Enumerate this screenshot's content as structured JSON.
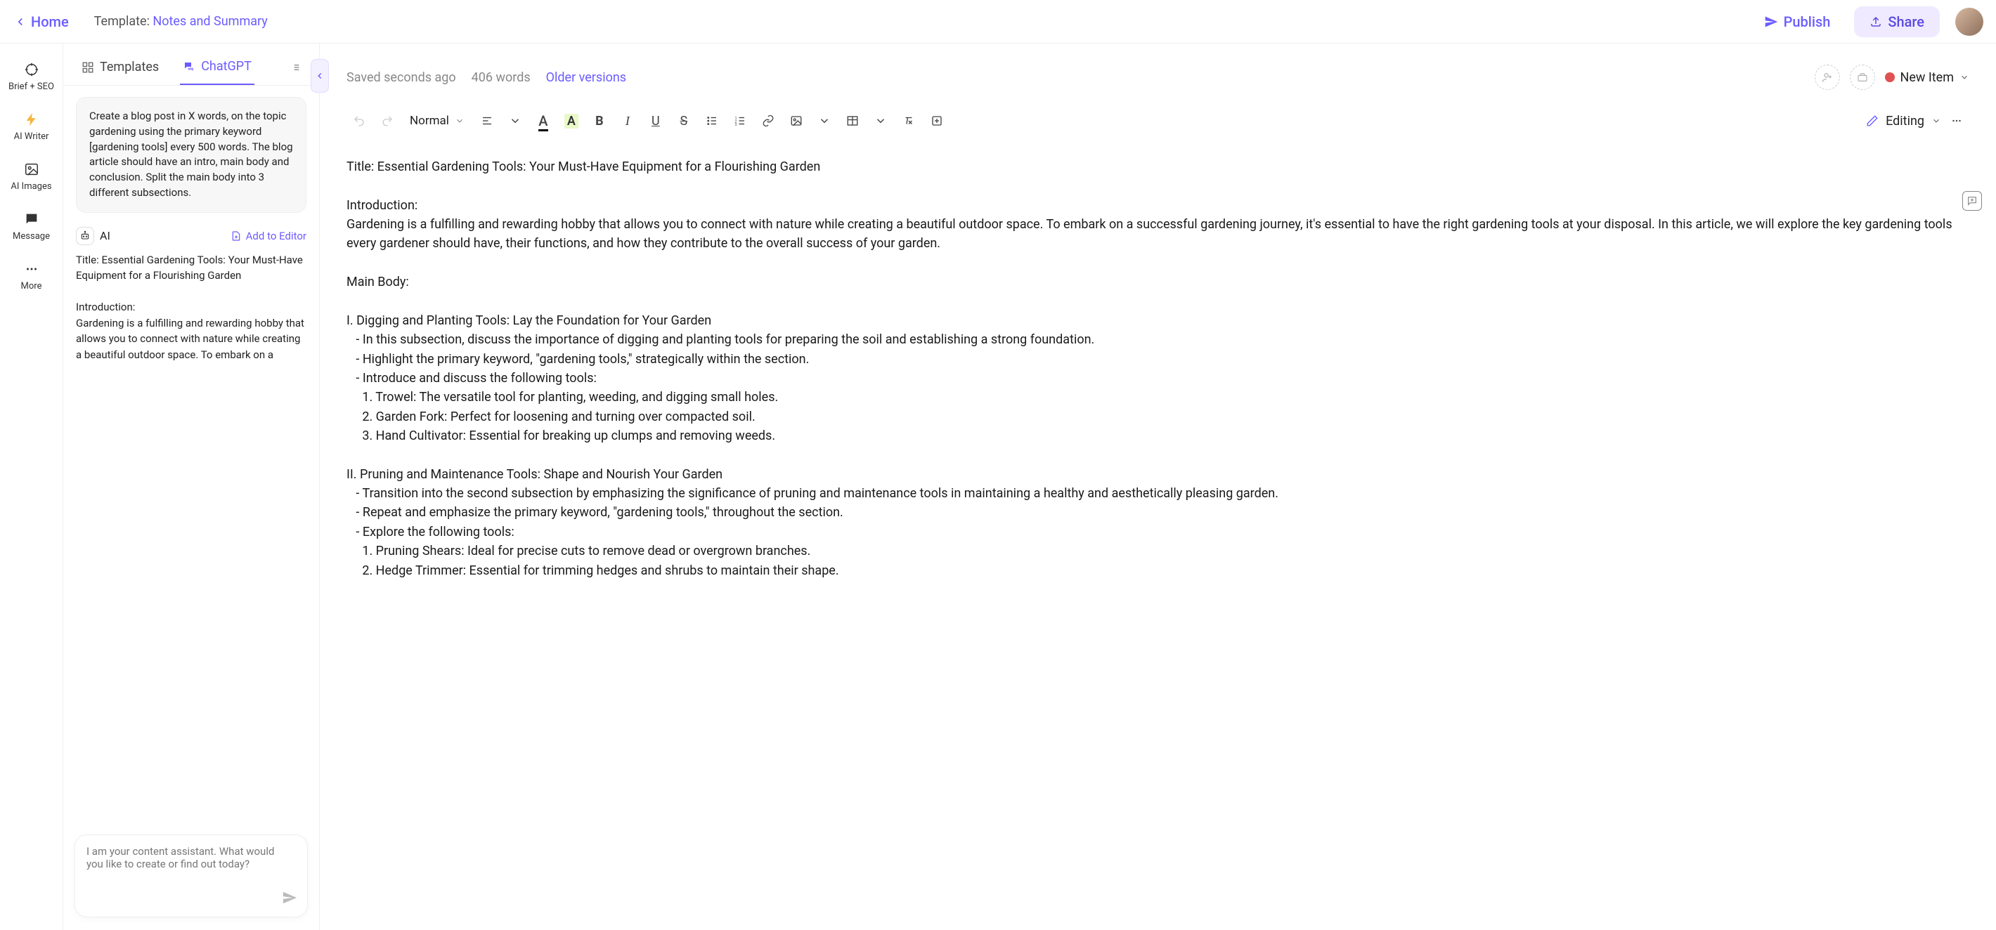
{
  "top": {
    "home": "Home",
    "template_label": "Template: ",
    "template_value": "Notes and Summary",
    "publish": "Publish",
    "share": "Share"
  },
  "rail": [
    {
      "label": "Brief + SEO",
      "icon": "target"
    },
    {
      "label": "AI Writer",
      "icon": "bolt"
    },
    {
      "label": "AI Images",
      "icon": "image"
    },
    {
      "label": "Message",
      "icon": "chat"
    },
    {
      "label": "More",
      "icon": "dots"
    }
  ],
  "tabs": {
    "templates": "Templates",
    "chatgpt": "ChatGPT"
  },
  "chat": {
    "user_msg": "Create a blog post in X words, on the topic gardening using the primary keyword [gardening tools] every 500 words. The blog article should have an intro, main body and conclusion. Split the main body into 3 different subsections.",
    "ai_label": "AI",
    "add_to_editor": "Add to Editor",
    "ai_msg": "Title: Essential Gardening Tools: Your Must-Have Equipment for a Flourishing Garden\n\nIntroduction:\nGardening is a fulfilling and rewarding hobby that allows you to connect with nature while creating a beautiful outdoor space. To embark on a",
    "input_placeholder": "I am your content assistant. What would you like to create or find out today?"
  },
  "status": {
    "saved": "Saved seconds ago",
    "words": "406 words",
    "older": "Older versions",
    "new_item": "New Item"
  },
  "toolbar": {
    "style": "Normal",
    "mode": "Editing"
  },
  "document": "Title: Essential Gardening Tools: Your Must-Have Equipment for a Flourishing Garden\n\nIntroduction:\nGardening is a fulfilling and rewarding hobby that allows you to connect with nature while creating a beautiful outdoor space. To embark on a successful gardening journey, it's essential to have the right gardening tools at your disposal. In this article, we will explore the key gardening tools every gardener should have, their functions, and how they contribute to the overall success of your garden.\n\nMain Body:\n\nI. Digging and Planting Tools: Lay the Foundation for Your Garden\n   - In this subsection, discuss the importance of digging and planting tools for preparing the soil and establishing a strong foundation.\n   - Highlight the primary keyword, \"gardening tools,\" strategically within the section.\n   - Introduce and discuss the following tools:\n     1. Trowel: The versatile tool for planting, weeding, and digging small holes.\n     2. Garden Fork: Perfect for loosening and turning over compacted soil.\n     3. Hand Cultivator: Essential for breaking up clumps and removing weeds.\n\nII. Pruning and Maintenance Tools: Shape and Nourish Your Garden\n   - Transition into the second subsection by emphasizing the significance of pruning and maintenance tools in maintaining a healthy and aesthetically pleasing garden.\n   - Repeat and emphasize the primary keyword, \"gardening tools,\" throughout the section.\n   - Explore the following tools:\n     1. Pruning Shears: Ideal for precise cuts to remove dead or overgrown branches.\n     2. Hedge Trimmer: Essential for trimming hedges and shrubs to maintain their shape."
}
